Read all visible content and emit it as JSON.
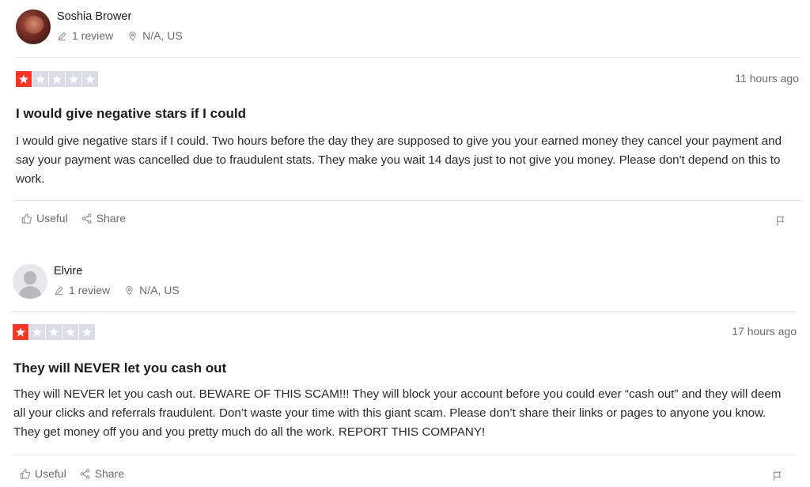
{
  "reviews": [
    {
      "reviewer_name": "Soshia Brower",
      "review_count": "1 review",
      "location": "N/A, US",
      "rating": 1,
      "date": "11 hours ago",
      "title": "I would give negative stars if I could",
      "body": "I would give negative stars if I could. Two hours before the day they are supposed to give you your earned money they cancel your payment and say your payment was cancelled due to fraudulent stats. They make you wait 14 days just to not give you money. Please don't depend on this to work.",
      "useful_label": "Useful",
      "share_label": "Share"
    },
    {
      "reviewer_name": "Elvire",
      "review_count": "1 review",
      "location": "N/A, US",
      "rating": 1,
      "date": "17 hours ago",
      "title": "They will NEVER let you cash out",
      "body": "They will NEVER let you cash out. BEWARE OF THIS SCAM!!! They will block your account before you could ever “cash out” and they will deem all your clicks and referrals fraudulent. Don’t waste your time with this giant scam. Please don’t share their links or pages to anyone you know. They get money off you and you pretty much do all the work. REPORT THIS COMPANY!",
      "useful_label": "Useful",
      "share_label": "Share"
    }
  ],
  "colors": {
    "star_active": "#ff3722",
    "star_inactive": "#dcdce6",
    "muted_text": "#6b6b70"
  },
  "icons": {
    "edit": "pencil-icon",
    "location": "location-pin-icon",
    "useful": "thumbs-up-icon",
    "share": "share-icon",
    "report": "flag-icon"
  }
}
